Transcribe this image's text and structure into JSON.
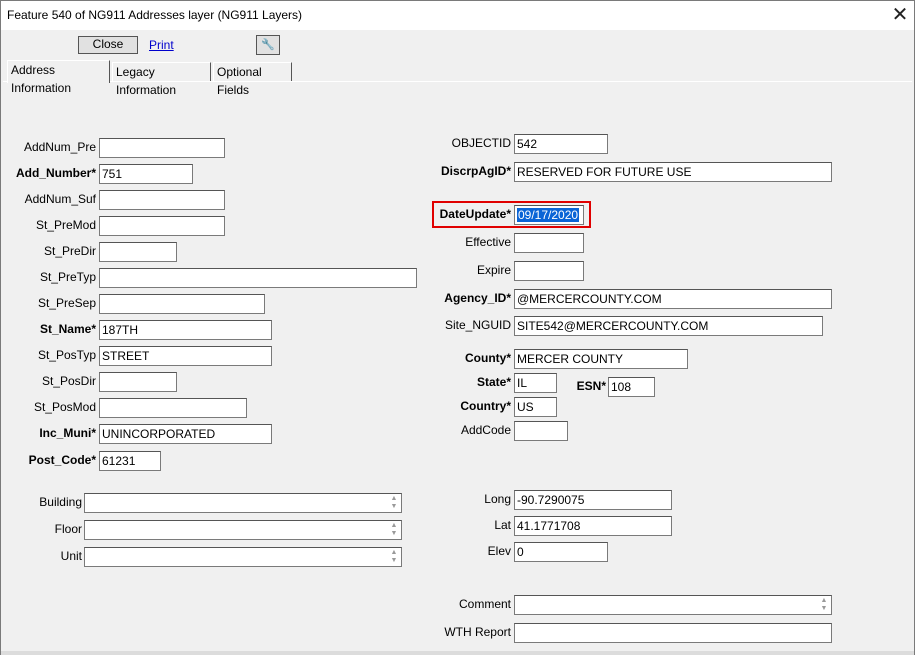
{
  "window": {
    "title": "Feature 540 of NG911 Addresses layer  (NG911 Layers)",
    "close_glyph": "✕"
  },
  "toolbar": {
    "close_label": "Close",
    "print_label": "Print",
    "wrench_glyph": "🔧"
  },
  "tabs": [
    {
      "label": "Address Information"
    },
    {
      "label": "Legacy Information"
    },
    {
      "label": "Optional Fields"
    }
  ],
  "left_fields": [
    {
      "label": "AddNum_Pre",
      "value": ""
    },
    {
      "label": "Add_Number*",
      "value": "751"
    },
    {
      "label": "AddNum_Suf",
      "value": ""
    },
    {
      "label": "St_PreMod",
      "value": ""
    },
    {
      "label": "St_PreDir",
      "value": ""
    },
    {
      "label": "St_PreTyp",
      "value": ""
    },
    {
      "label": "St_PreSep",
      "value": ""
    },
    {
      "label": "St_Name*",
      "value": "187TH"
    },
    {
      "label": "St_PosTyp",
      "value": "STREET"
    },
    {
      "label": "St_PosDir",
      "value": ""
    },
    {
      "label": "St_PosMod",
      "value": ""
    },
    {
      "label": "Inc_Muni*",
      "value": "UNINCORPORATED"
    },
    {
      "label": "Post_Code*",
      "value": "61231"
    }
  ],
  "left_lower": [
    {
      "label": "Building",
      "value": ""
    },
    {
      "label": "Floor",
      "value": ""
    },
    {
      "label": "Unit",
      "value": ""
    }
  ],
  "right_fields": {
    "objectid": {
      "label": "OBJECTID",
      "value": "542"
    },
    "discrpagid": {
      "label": "DiscrpAgID*",
      "value": "RESERVED FOR FUTURE USE"
    },
    "dateupdate": {
      "label": "DateUpdate*",
      "value": "09/17/2020"
    },
    "effective": {
      "label": "Effective",
      "value": ""
    },
    "expire": {
      "label": "Expire",
      "value": ""
    },
    "agency_id": {
      "label": "Agency_ID*",
      "value": "@MERCERCOUNTY.COM"
    },
    "site_nguid": {
      "label": "Site_NGUID",
      "value": "SITE542@MERCERCOUNTY.COM"
    },
    "county": {
      "label": "County*",
      "value": "MERCER COUNTY"
    },
    "state": {
      "label": "State*",
      "value": "IL"
    },
    "esn": {
      "label": "ESN*",
      "value": "108"
    },
    "country": {
      "label": "Country*",
      "value": "US"
    },
    "addcode": {
      "label": "AddCode",
      "value": ""
    },
    "long": {
      "label": "Long",
      "value": "-90.7290075"
    },
    "lat": {
      "label": "Lat",
      "value": "41.1771708"
    },
    "elev": {
      "label": "Elev",
      "value": "0"
    },
    "comment": {
      "label": "Comment",
      "value": ""
    },
    "wth_report": {
      "label": "WTH Report",
      "value": ""
    }
  },
  "colors": {
    "highlight_border": "#e00000",
    "selection": "#0a64d6",
    "link": "#0000cc"
  }
}
